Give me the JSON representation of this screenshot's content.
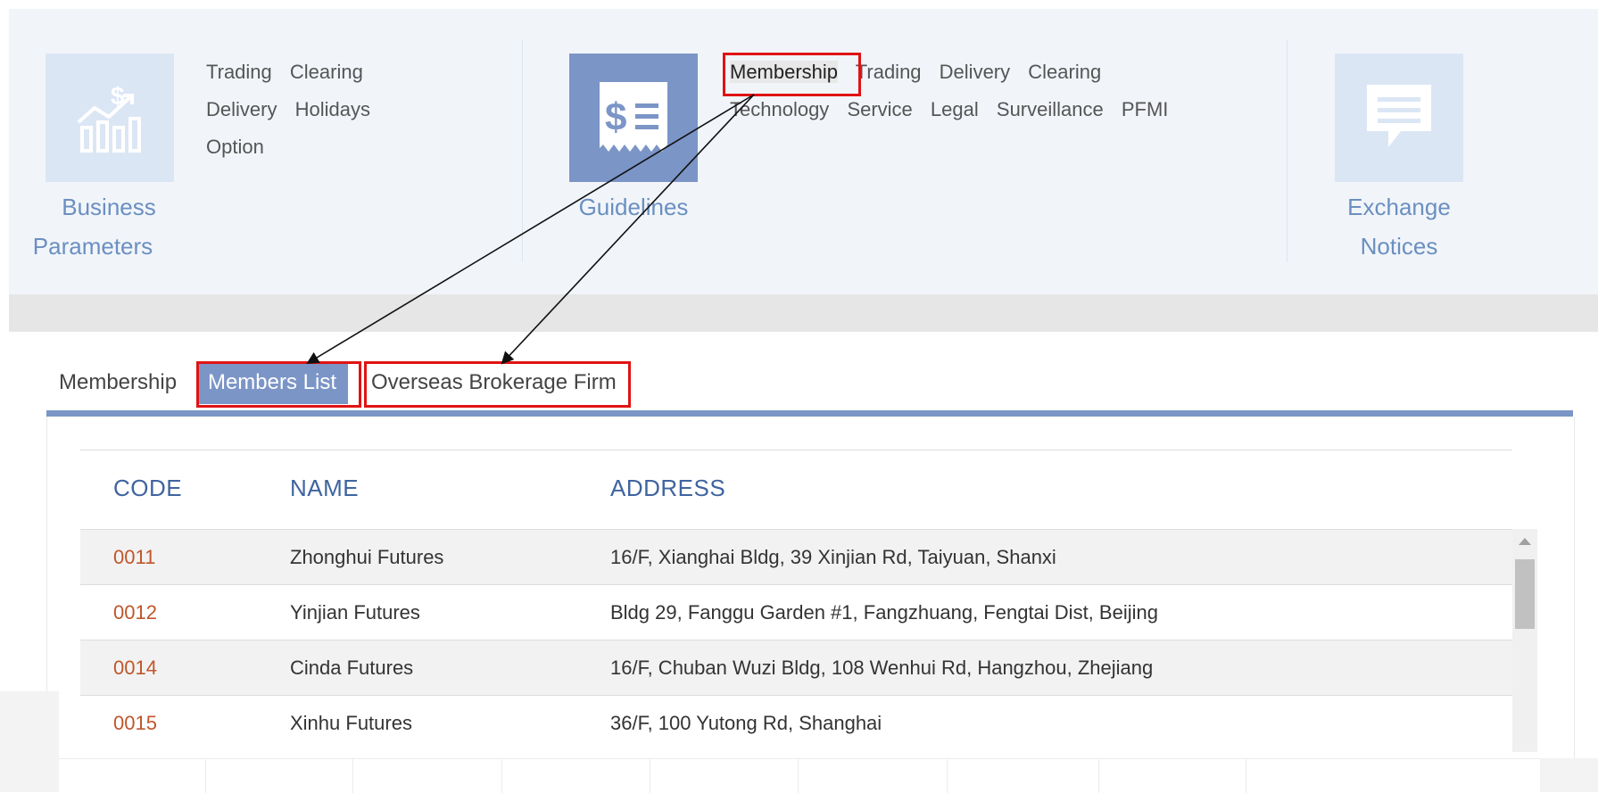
{
  "business_parameters": {
    "icon": "finance-chart-icon",
    "label_line1": "Business",
    "label_line2": "Parameters",
    "links": [
      "Trading",
      "Clearing",
      "Delivery",
      "Holidays",
      "Option"
    ]
  },
  "guidelines": {
    "icon": "receipt-dollar-icon",
    "label": "Guidelines",
    "links_row1": [
      "Membership",
      "Trading",
      "Delivery",
      "Clearing"
    ],
    "links_row2": [
      "Technology",
      "Service",
      "Legal",
      "Surveillance",
      "PFMI"
    ]
  },
  "exchange_notices": {
    "icon": "speech-bubble-icon",
    "label_line1": "Exchange",
    "label_line2": "Notices"
  },
  "tabs": [
    {
      "label": "Membership",
      "active": false
    },
    {
      "label": "Members List",
      "active": true
    },
    {
      "label": "Overseas Brokerage Firm",
      "active": false
    }
  ],
  "table": {
    "headers": {
      "code": "CODE",
      "name": "NAME",
      "address": "ADDRESS"
    },
    "rows": [
      {
        "code": "0011",
        "name": "Zhonghui Futures",
        "address": "16/F, Xianghai Bldg, 39 Xinjian Rd, Taiyuan, Shanxi"
      },
      {
        "code": "0012",
        "name": "Yinjian Futures",
        "address": "Bldg 29, Fanggu Garden #1, Fangzhuang, Fengtai Dist, Beijing"
      },
      {
        "code": "0014",
        "name": "Cinda Futures",
        "address": "16/F, Chuban Wuzi Bldg, 108 Wenhui Rd, Hangzhou, Zhejiang"
      },
      {
        "code": "0015",
        "name": "Xinhu Futures",
        "address": "36/F, 100 Yutong Rd, Shanghai"
      }
    ]
  },
  "colors": {
    "accent": "#7b95c7",
    "label_blue": "#6b8fc0",
    "code_orange": "#c0562a",
    "highlight_red": "#e01313"
  }
}
